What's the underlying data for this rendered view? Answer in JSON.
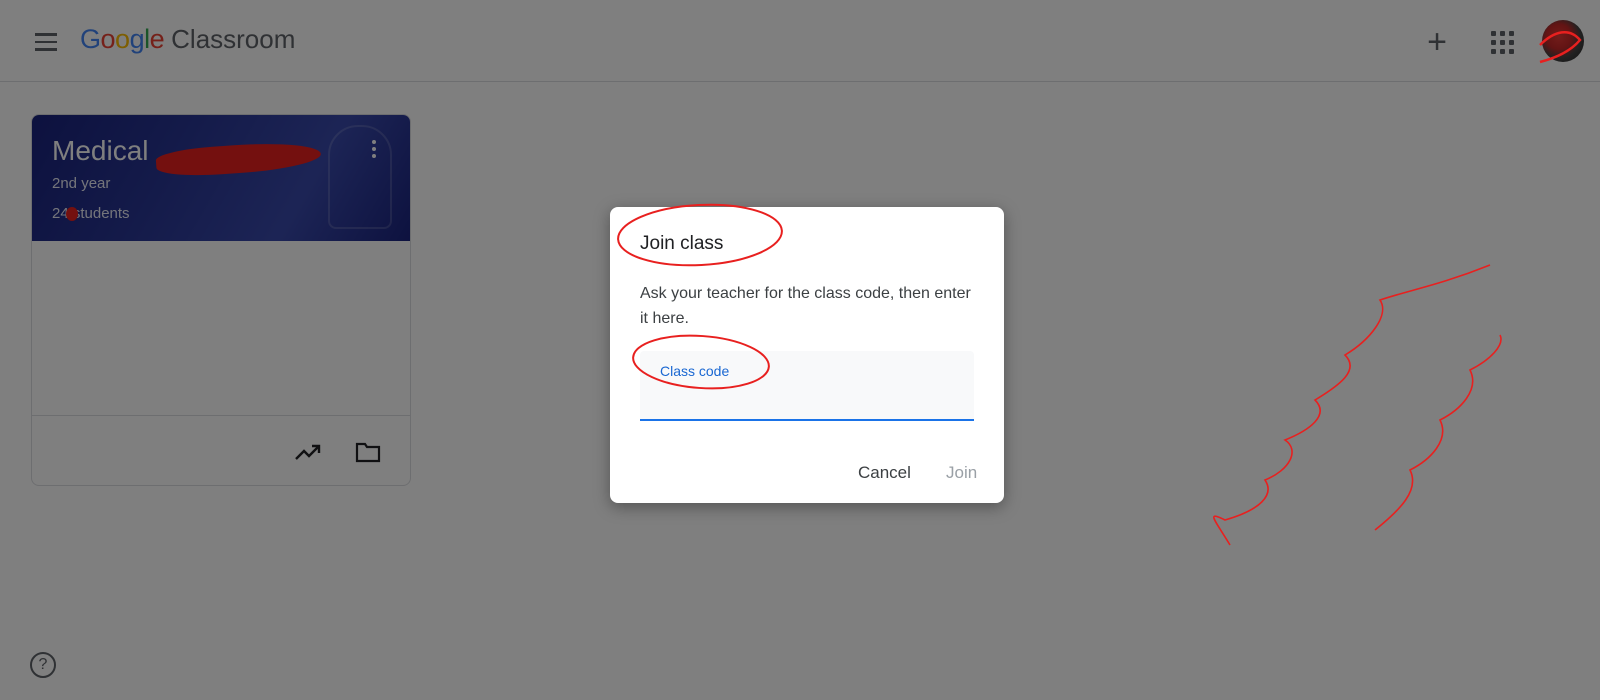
{
  "header": {
    "logo_google": [
      "G",
      "o",
      "o",
      "g",
      "l",
      "e"
    ],
    "logo_colors": [
      "#4285F4",
      "#EA4335",
      "#FBBC05",
      "#4285F4",
      "#34A853",
      "#EA4335"
    ],
    "logo_classroom": "Classroom",
    "plus_symbol": "+"
  },
  "class_card": {
    "title": "Medical",
    "subtitle": "2nd year",
    "students": "24 students",
    "banner_color": "#283593"
  },
  "dialog": {
    "title": "Join class",
    "description": "Ask your teacher for the class code, then enter it here.",
    "field_label": "Class code",
    "field_value": "",
    "cancel_label": "Cancel",
    "join_label": "Join",
    "accent_color": "#1a73e8"
  },
  "help_symbol": "?",
  "annotation_color": "#e8201f"
}
